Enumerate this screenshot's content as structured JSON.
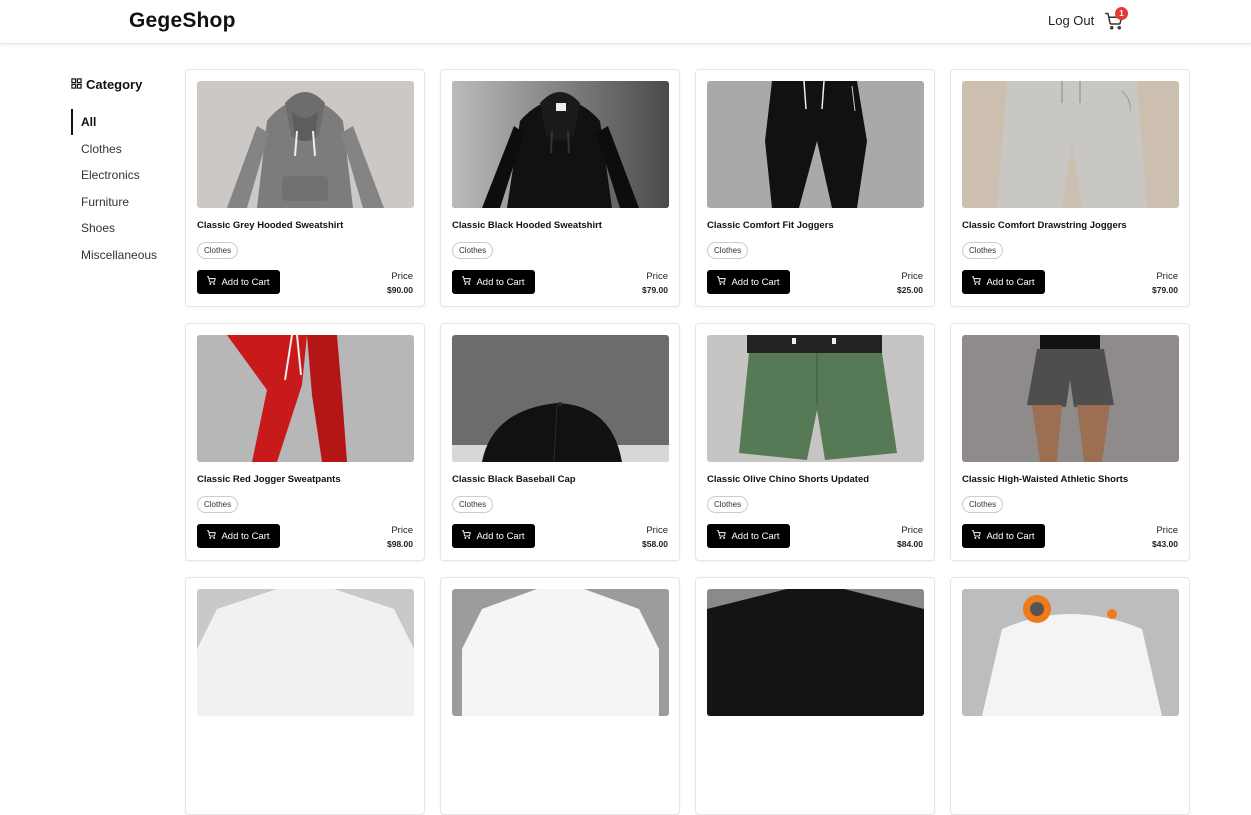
{
  "header": {
    "logo": "GegeShop",
    "logout": "Log Out",
    "cart_count": "1"
  },
  "sidebar": {
    "title": "Category",
    "items": [
      {
        "label": "All",
        "active": true
      },
      {
        "label": "Clothes"
      },
      {
        "label": "Electronics"
      },
      {
        "label": "Furniture"
      },
      {
        "label": "Shoes"
      },
      {
        "label": "Miscellaneous"
      }
    ]
  },
  "products": [
    {
      "title": "Classic Grey Hooded Sweatshirt",
      "tag": "Clothes",
      "button": "Add to Cart",
      "price_label": "Price",
      "price": "$90.00",
      "image": "grey-hoodie"
    },
    {
      "title": "Classic Black Hooded Sweatshirt",
      "tag": "Clothes",
      "button": "Add to Cart",
      "price_label": "Price",
      "price": "$79.00",
      "image": "black-hoodie"
    },
    {
      "title": "Classic Comfort Fit Joggers",
      "tag": "Clothes",
      "button": "Add to Cart",
      "price_label": "Price",
      "price": "$25.00",
      "image": "black-joggers"
    },
    {
      "title": "Classic Comfort Drawstring Joggers",
      "tag": "Clothes",
      "button": "Add to Cart",
      "price_label": "Price",
      "price": "$79.00",
      "image": "beige-joggers"
    },
    {
      "title": "Classic Red Jogger Sweatpants",
      "tag": "Clothes",
      "button": "Add to Cart",
      "price_label": "Price",
      "price": "$98.00",
      "image": "red-joggers"
    },
    {
      "title": "Classic Black Baseball Cap",
      "tag": "Clothes",
      "button": "Add to Cart",
      "price_label": "Price",
      "price": "$58.00",
      "image": "black-cap"
    },
    {
      "title": "Classic Olive Chino Shorts Updated",
      "tag": "Clothes",
      "button": "Add to Cart",
      "price_label": "Price",
      "price": "$84.00",
      "image": "olive-shorts"
    },
    {
      "title": "Classic High-Waisted Athletic Shorts",
      "tag": "Clothes",
      "button": "Add to Cart",
      "price_label": "Price",
      "price": "$43.00",
      "image": "athletic-shorts"
    },
    {
      "image": "white-tshirt"
    },
    {
      "image": "white-tshirt-2"
    },
    {
      "image": "black-tshirt"
    },
    {
      "image": "game-controller"
    }
  ]
}
